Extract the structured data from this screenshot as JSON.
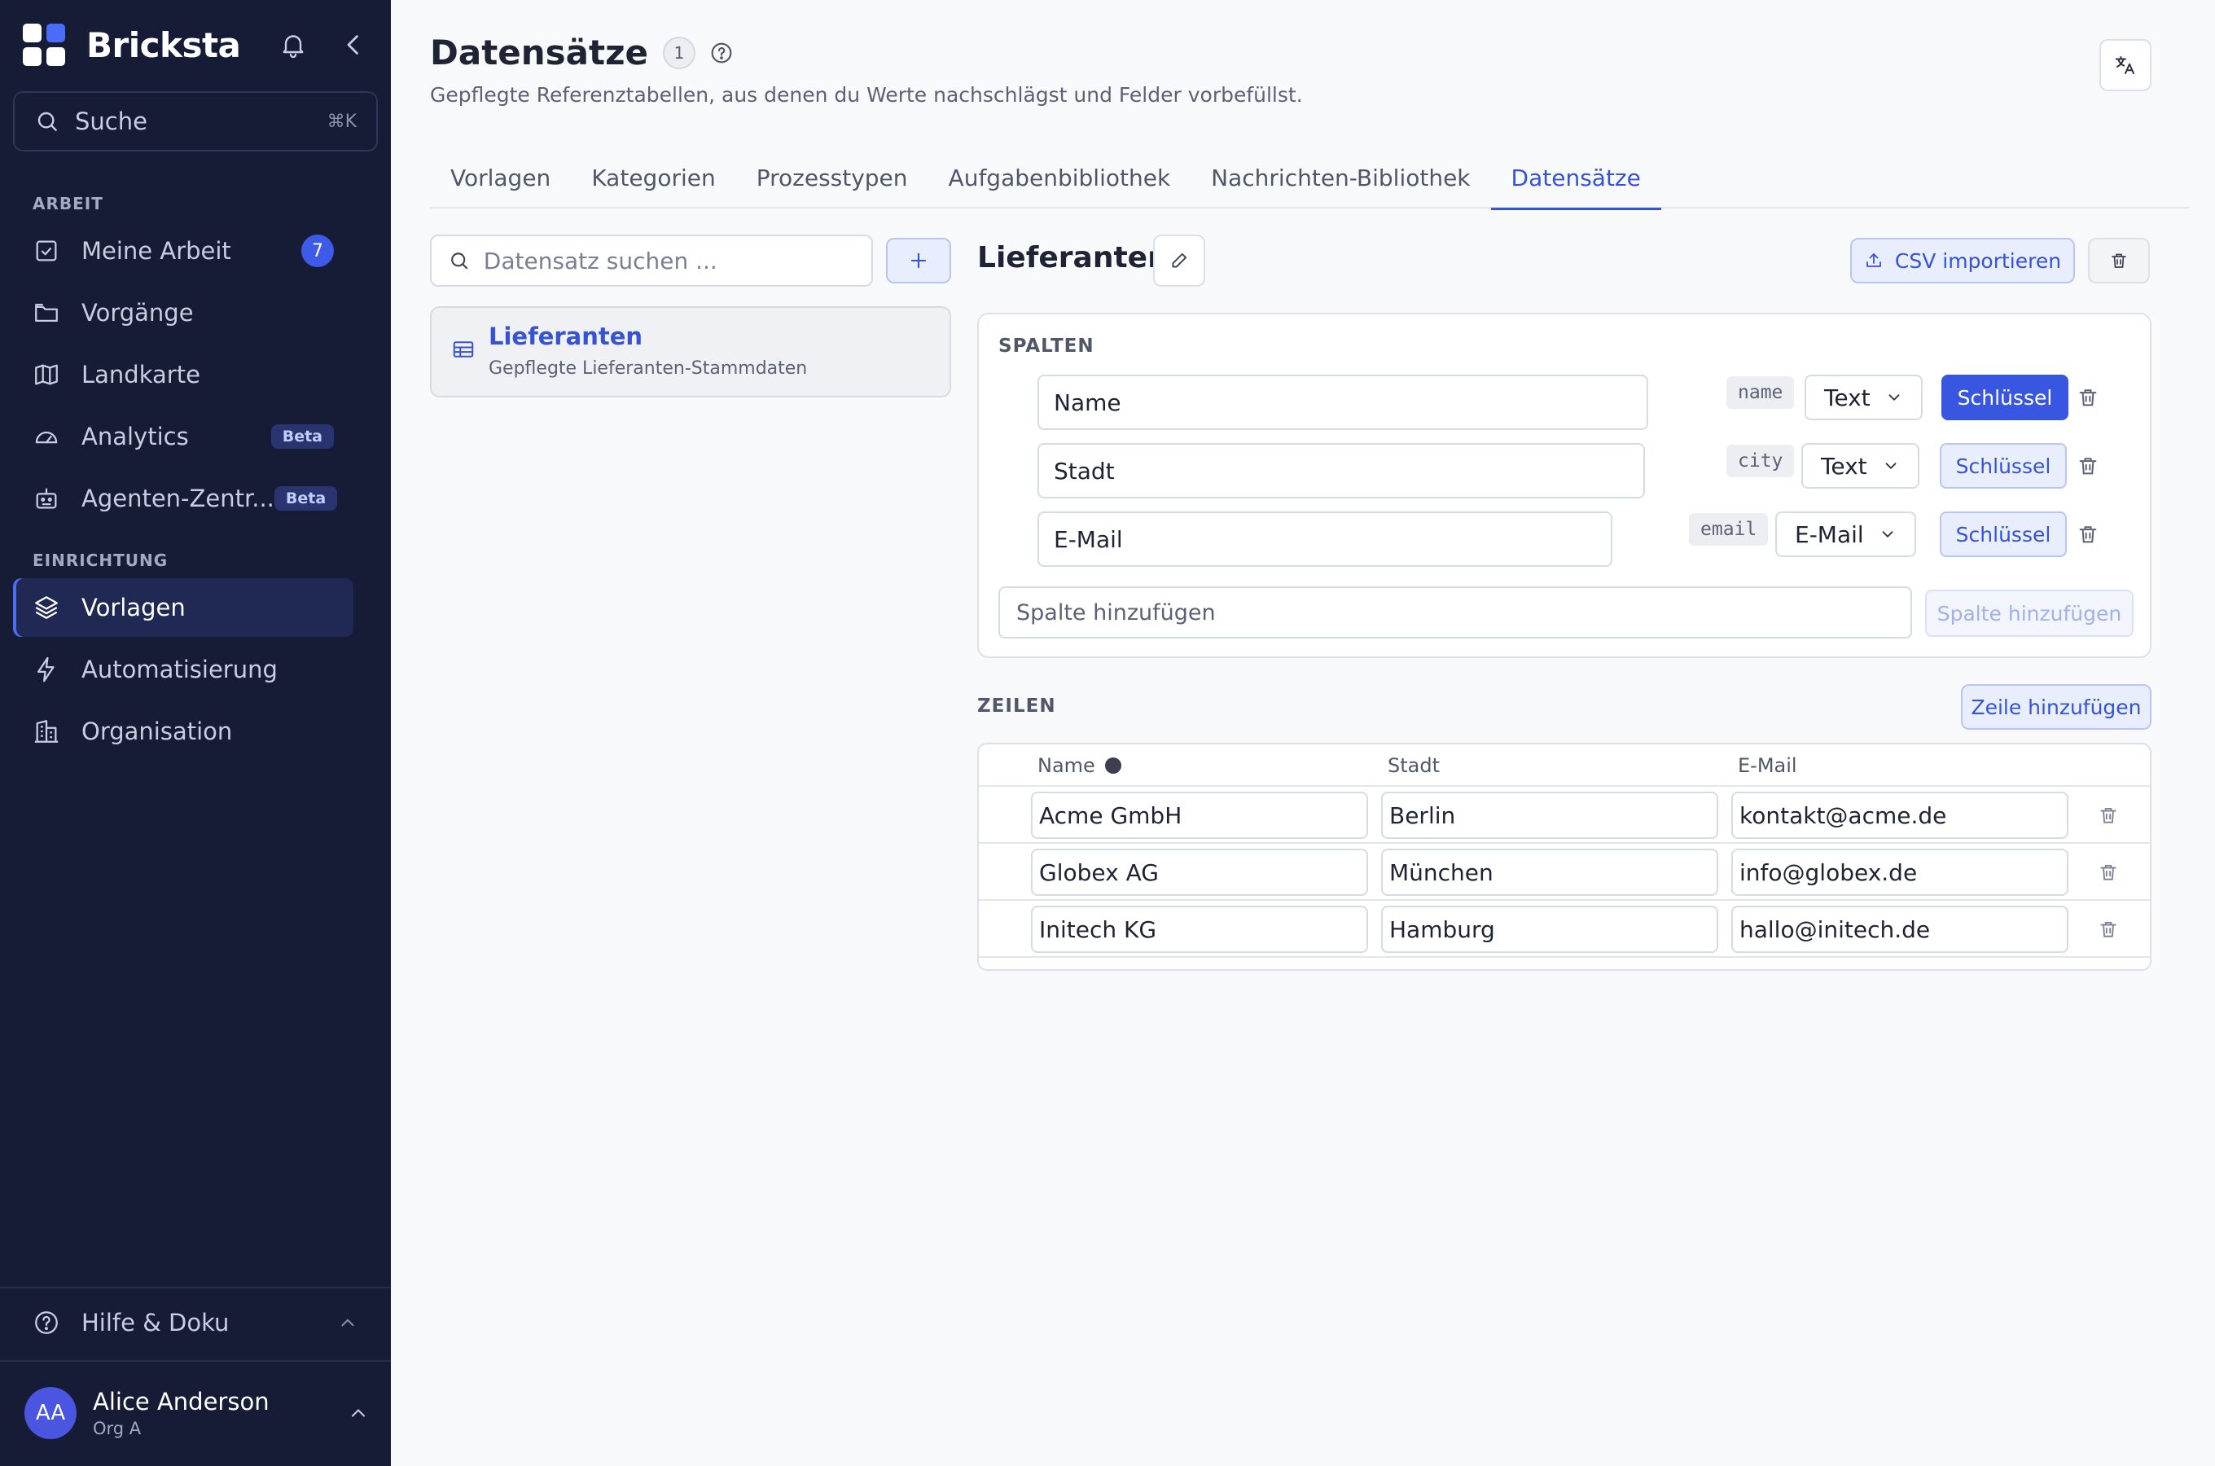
{
  "app": {
    "name": "Bricksta"
  },
  "sidebar": {
    "search": {
      "label": "Suche",
      "shortcut": "⌘K"
    },
    "section_work": "ARBEIT",
    "section_setup": "EINRICHTUNG",
    "items": [
      {
        "label": "Meine Arbeit",
        "badge": "7"
      },
      {
        "label": "Vorgänge"
      },
      {
        "label": "Landkarte"
      },
      {
        "label": "Analytics",
        "badge": "Beta"
      },
      {
        "label": "Agenten-Zentr...",
        "badge": "Beta"
      },
      {
        "label": "Vorlagen",
        "active": true
      },
      {
        "label": "Automatisierung"
      },
      {
        "label": "Organisation"
      }
    ],
    "help": "Hilfe & Doku",
    "user": {
      "initials": "AA",
      "name": "Alice Anderson",
      "org": "Org A"
    }
  },
  "header": {
    "title": "Datensätze",
    "count": "1",
    "subtitle": "Gepflegte Referenztabellen, aus denen du Werte nachschlägst und Felder vorbefüllst."
  },
  "tabs": [
    {
      "label": "Vorlagen"
    },
    {
      "label": "Kategorien"
    },
    {
      "label": "Prozesstypen"
    },
    {
      "label": "Aufgabenbibliothek"
    },
    {
      "label": "Nachrichten-Bibliothek"
    },
    {
      "label": "Datensätze",
      "active": true
    }
  ],
  "datasets": {
    "search_placeholder": "Datensatz suchen ...",
    "items": [
      {
        "name": "Lieferanten",
        "description": "Gepflegte Lieferanten-Stammdaten"
      }
    ]
  },
  "detail": {
    "title": "Lieferanten",
    "import_csv": "CSV importieren",
    "columns_label": "SPALTEN",
    "columns": [
      {
        "name": "Name",
        "key": "name",
        "type": "Text",
        "key_label": "Schlüssel",
        "is_key": true
      },
      {
        "name": "Stadt",
        "key": "city",
        "type": "Text",
        "key_label": "Schlüssel",
        "is_key": false
      },
      {
        "name": "E-Mail",
        "key": "email",
        "type": "E-Mail",
        "key_label": "Schlüssel",
        "is_key": false
      }
    ],
    "add_column_placeholder": "Spalte hinzufügen",
    "add_column_button": "Spalte hinzufügen",
    "rows_label": "ZEILEN",
    "add_row_button": "Zeile hinzufügen",
    "table_headers": [
      "Name",
      "Stadt",
      "E-Mail"
    ],
    "rows": [
      [
        "Acme GmbH",
        "Berlin",
        "kontakt@acme.de"
      ],
      [
        "Globex AG",
        "München",
        "info@globex.de"
      ],
      [
        "Initech KG",
        "Hamburg",
        "hallo@initech.de"
      ]
    ]
  },
  "colors": {
    "accent": "#3553d4",
    "sidebar_bg": "#161b36",
    "key_active": "#3856e0"
  }
}
